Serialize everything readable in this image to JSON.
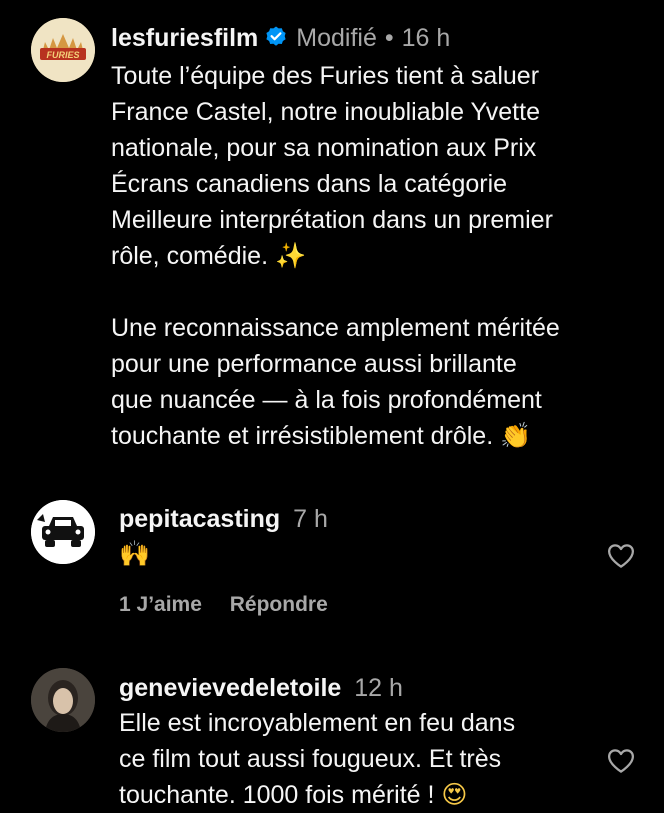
{
  "colors": {
    "background": "#000000",
    "text": "#f5f5f5",
    "secondary": "#a8a8a8",
    "verified": "#0095f6",
    "logo_gold": "#c9a24a"
  },
  "post": {
    "username": "lesfuriesfilm",
    "verified_icon": "verified-badge-icon",
    "edited": "Modifié",
    "separator": "•",
    "time": "16 h",
    "logo_text": "FURIES",
    "paragraph1": "Toute l’équipe des Furies tient à saluer\nFrance Castel, notre inoubliable Yvette\nnationale, pour sa nomination aux Prix\nÉcrans canadiens dans la catégorie\nMeilleure interprétation dans un premier\nrôle, comédie. ",
    "paragraph1_emoji": "✨",
    "paragraph2": "Une reconnaissance amplement méritée\npour une performance aussi brillante\nque nuancée — à la fois profondément\ntouchante et irrésistiblement drôle. ",
    "paragraph2_emoji": "👏"
  },
  "comments": [
    {
      "username": "pepitacasting",
      "time": "7 h",
      "text": "🙌",
      "likes": "1 J’aime",
      "reply": "Répondre",
      "heart_icon": "heart-outline-icon"
    },
    {
      "username": "genevievedeletoile",
      "time": "12 h",
      "text": "Elle est incroyablement en feu dans\nce film tout aussi fougueux. Et très\ntouchante. 1000 fois mérité ! ",
      "text_emoji": "😍",
      "heart_icon": "heart-outline-icon"
    }
  ]
}
